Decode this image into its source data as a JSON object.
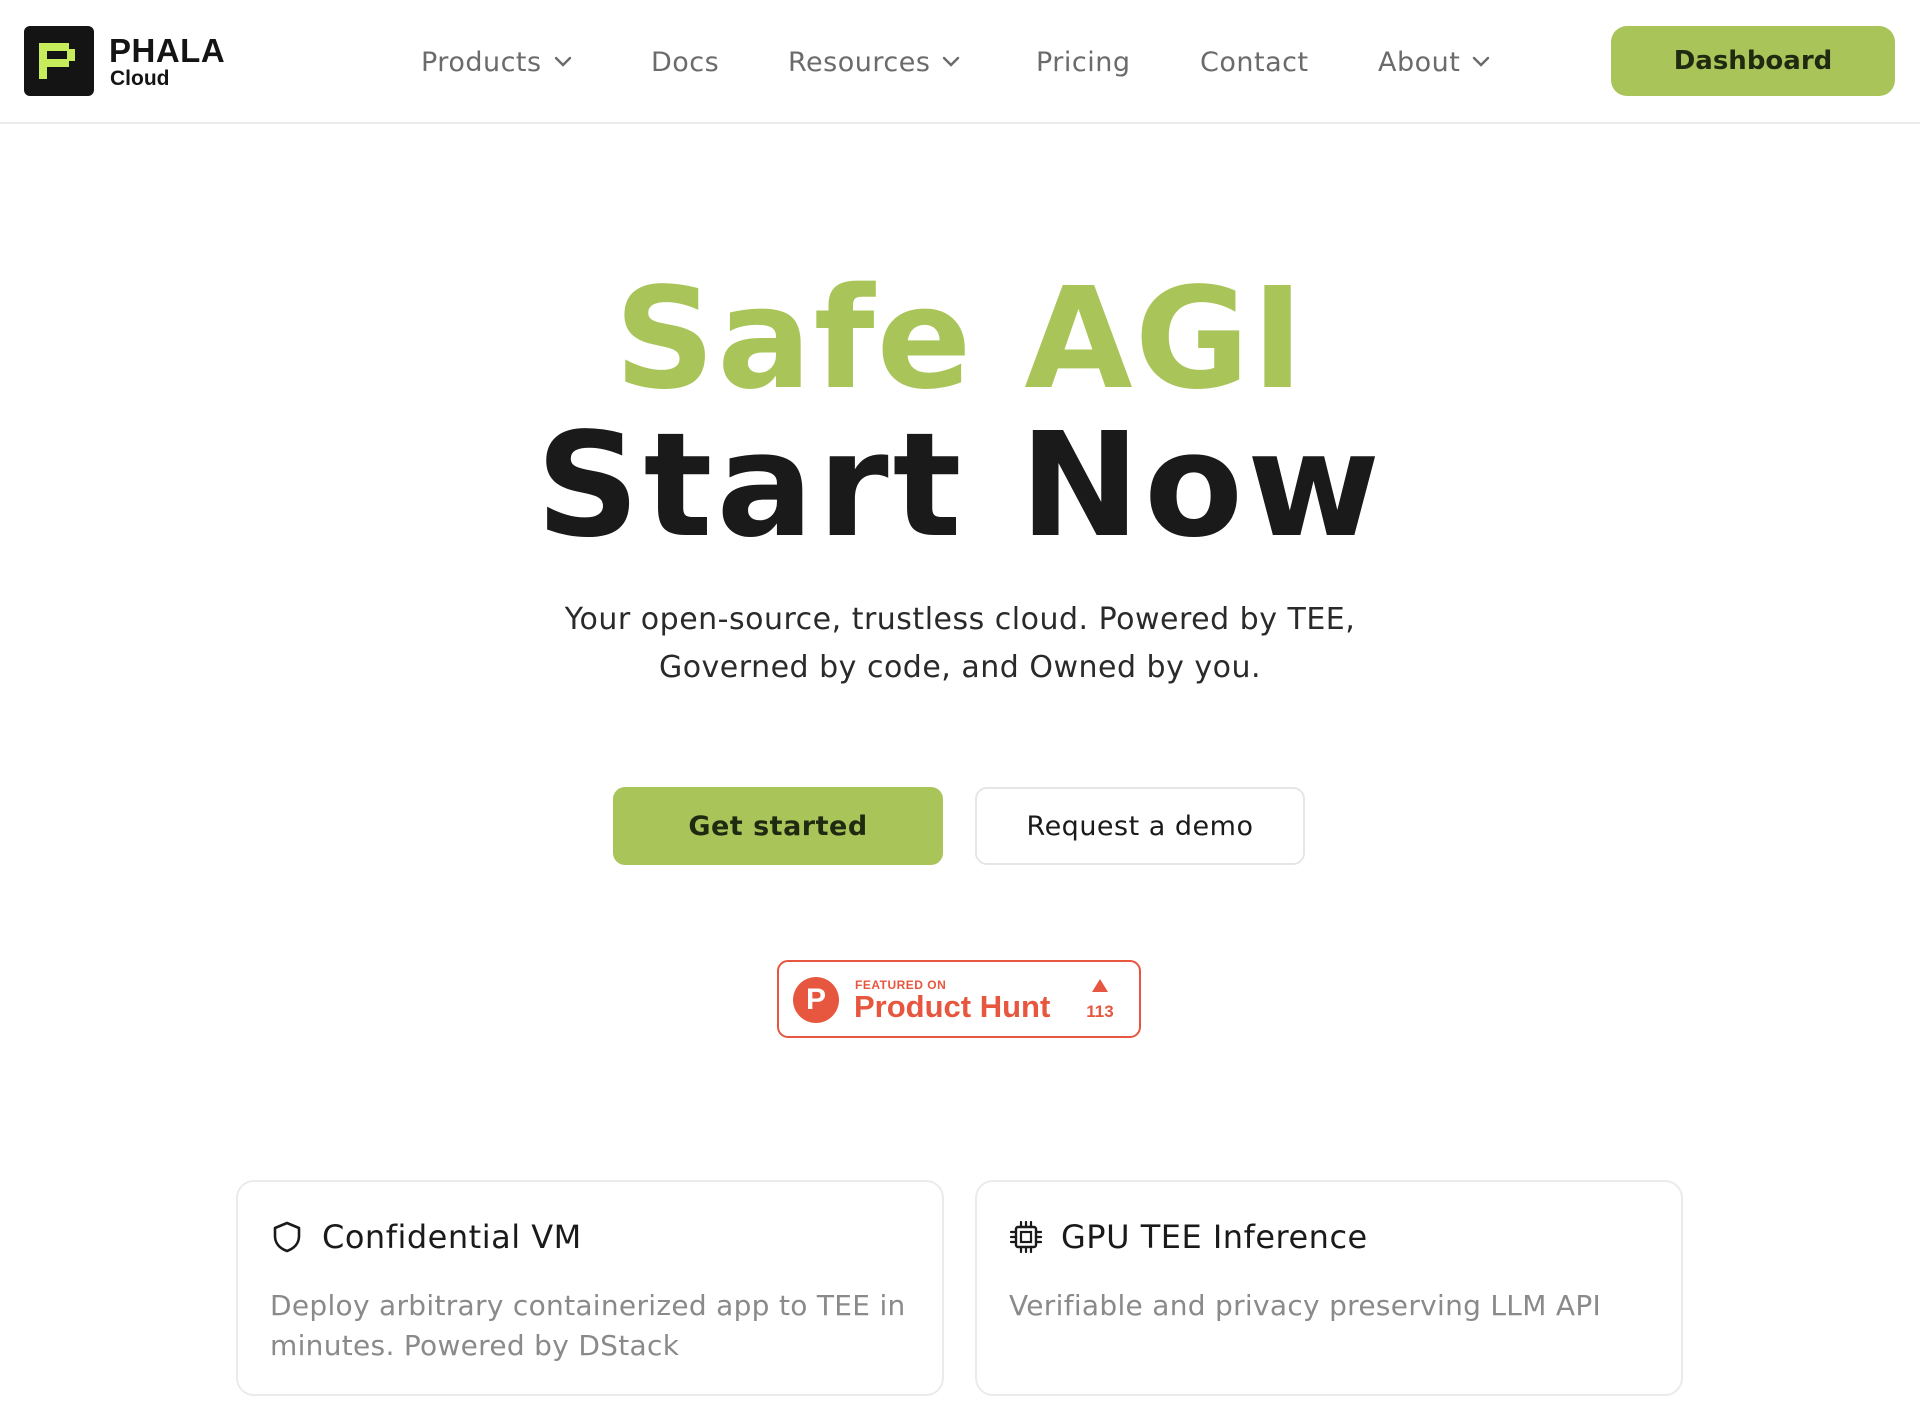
{
  "header": {
    "logo": {
      "name": "PHALA",
      "sub": "Cloud",
      "icon": "phala-pixel-logo-icon"
    },
    "nav": [
      {
        "label": "Products",
        "has_dropdown": true
      },
      {
        "label": "Docs",
        "has_dropdown": false
      },
      {
        "label": "Resources",
        "has_dropdown": true
      },
      {
        "label": "Pricing",
        "has_dropdown": false
      },
      {
        "label": "Contact",
        "has_dropdown": false
      },
      {
        "label": "About",
        "has_dropdown": true
      }
    ],
    "dashboard_label": "Dashboard"
  },
  "hero": {
    "title_line1": "Safe AGI",
    "title_line2": "Start Now",
    "subtitle_line1": "Your open-source, trustless cloud. Powered by TEE,",
    "subtitle_line2": "Governed by code, and Owned by you.",
    "primary_cta": "Get started",
    "secondary_cta": "Request a demo"
  },
  "product_hunt": {
    "featured": "FEATURED ON",
    "name": "Product Hunt",
    "letter": "P",
    "upvotes": "113"
  },
  "features": [
    {
      "icon": "shield-icon",
      "title": "Confidential VM",
      "description": "Deploy arbitrary containerized app to TEE in minutes. Powered by DStack"
    },
    {
      "icon": "cpu-chip-icon",
      "title": "GPU TEE Inference",
      "description": "Verifiable and privacy preserving LLM API"
    }
  ],
  "colors": {
    "accent": "#a9c55a",
    "product_hunt": "#e7573f",
    "text_dark": "#1a1a1a",
    "text_muted": "#8a8a8a"
  }
}
